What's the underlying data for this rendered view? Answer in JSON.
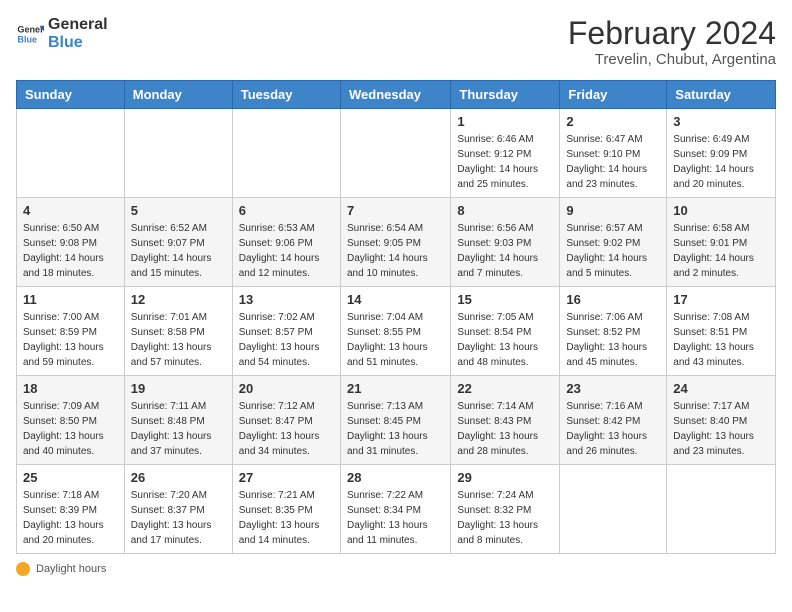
{
  "logo": {
    "general": "General",
    "blue": "Blue"
  },
  "title": "February 2024",
  "subtitle": "Trevelin, Chubut, Argentina",
  "days_of_week": [
    "Sunday",
    "Monday",
    "Tuesday",
    "Wednesday",
    "Thursday",
    "Friday",
    "Saturday"
  ],
  "weeks": [
    [
      {
        "day": "",
        "info": ""
      },
      {
        "day": "",
        "info": ""
      },
      {
        "day": "",
        "info": ""
      },
      {
        "day": "",
        "info": ""
      },
      {
        "day": "1",
        "info": "Sunrise: 6:46 AM\nSunset: 9:12 PM\nDaylight: 14 hours and 25 minutes."
      },
      {
        "day": "2",
        "info": "Sunrise: 6:47 AM\nSunset: 9:10 PM\nDaylight: 14 hours and 23 minutes."
      },
      {
        "day": "3",
        "info": "Sunrise: 6:49 AM\nSunset: 9:09 PM\nDaylight: 14 hours and 20 minutes."
      }
    ],
    [
      {
        "day": "4",
        "info": "Sunrise: 6:50 AM\nSunset: 9:08 PM\nDaylight: 14 hours and 18 minutes."
      },
      {
        "day": "5",
        "info": "Sunrise: 6:52 AM\nSunset: 9:07 PM\nDaylight: 14 hours and 15 minutes."
      },
      {
        "day": "6",
        "info": "Sunrise: 6:53 AM\nSunset: 9:06 PM\nDaylight: 14 hours and 12 minutes."
      },
      {
        "day": "7",
        "info": "Sunrise: 6:54 AM\nSunset: 9:05 PM\nDaylight: 14 hours and 10 minutes."
      },
      {
        "day": "8",
        "info": "Sunrise: 6:56 AM\nSunset: 9:03 PM\nDaylight: 14 hours and 7 minutes."
      },
      {
        "day": "9",
        "info": "Sunrise: 6:57 AM\nSunset: 9:02 PM\nDaylight: 14 hours and 5 minutes."
      },
      {
        "day": "10",
        "info": "Sunrise: 6:58 AM\nSunset: 9:01 PM\nDaylight: 14 hours and 2 minutes."
      }
    ],
    [
      {
        "day": "11",
        "info": "Sunrise: 7:00 AM\nSunset: 8:59 PM\nDaylight: 13 hours and 59 minutes."
      },
      {
        "day": "12",
        "info": "Sunrise: 7:01 AM\nSunset: 8:58 PM\nDaylight: 13 hours and 57 minutes."
      },
      {
        "day": "13",
        "info": "Sunrise: 7:02 AM\nSunset: 8:57 PM\nDaylight: 13 hours and 54 minutes."
      },
      {
        "day": "14",
        "info": "Sunrise: 7:04 AM\nSunset: 8:55 PM\nDaylight: 13 hours and 51 minutes."
      },
      {
        "day": "15",
        "info": "Sunrise: 7:05 AM\nSunset: 8:54 PM\nDaylight: 13 hours and 48 minutes."
      },
      {
        "day": "16",
        "info": "Sunrise: 7:06 AM\nSunset: 8:52 PM\nDaylight: 13 hours and 45 minutes."
      },
      {
        "day": "17",
        "info": "Sunrise: 7:08 AM\nSunset: 8:51 PM\nDaylight: 13 hours and 43 minutes."
      }
    ],
    [
      {
        "day": "18",
        "info": "Sunrise: 7:09 AM\nSunset: 8:50 PM\nDaylight: 13 hours and 40 minutes."
      },
      {
        "day": "19",
        "info": "Sunrise: 7:11 AM\nSunset: 8:48 PM\nDaylight: 13 hours and 37 minutes."
      },
      {
        "day": "20",
        "info": "Sunrise: 7:12 AM\nSunset: 8:47 PM\nDaylight: 13 hours and 34 minutes."
      },
      {
        "day": "21",
        "info": "Sunrise: 7:13 AM\nSunset: 8:45 PM\nDaylight: 13 hours and 31 minutes."
      },
      {
        "day": "22",
        "info": "Sunrise: 7:14 AM\nSunset: 8:43 PM\nDaylight: 13 hours and 28 minutes."
      },
      {
        "day": "23",
        "info": "Sunrise: 7:16 AM\nSunset: 8:42 PM\nDaylight: 13 hours and 26 minutes."
      },
      {
        "day": "24",
        "info": "Sunrise: 7:17 AM\nSunset: 8:40 PM\nDaylight: 13 hours and 23 minutes."
      }
    ],
    [
      {
        "day": "25",
        "info": "Sunrise: 7:18 AM\nSunset: 8:39 PM\nDaylight: 13 hours and 20 minutes."
      },
      {
        "day": "26",
        "info": "Sunrise: 7:20 AM\nSunset: 8:37 PM\nDaylight: 13 hours and 17 minutes."
      },
      {
        "day": "27",
        "info": "Sunrise: 7:21 AM\nSunset: 8:35 PM\nDaylight: 13 hours and 14 minutes."
      },
      {
        "day": "28",
        "info": "Sunrise: 7:22 AM\nSunset: 8:34 PM\nDaylight: 13 hours and 11 minutes."
      },
      {
        "day": "29",
        "info": "Sunrise: 7:24 AM\nSunset: 8:32 PM\nDaylight: 13 hours and 8 minutes."
      },
      {
        "day": "",
        "info": ""
      },
      {
        "day": "",
        "info": ""
      }
    ]
  ],
  "footer": {
    "daylight_label": "Daylight hours"
  }
}
